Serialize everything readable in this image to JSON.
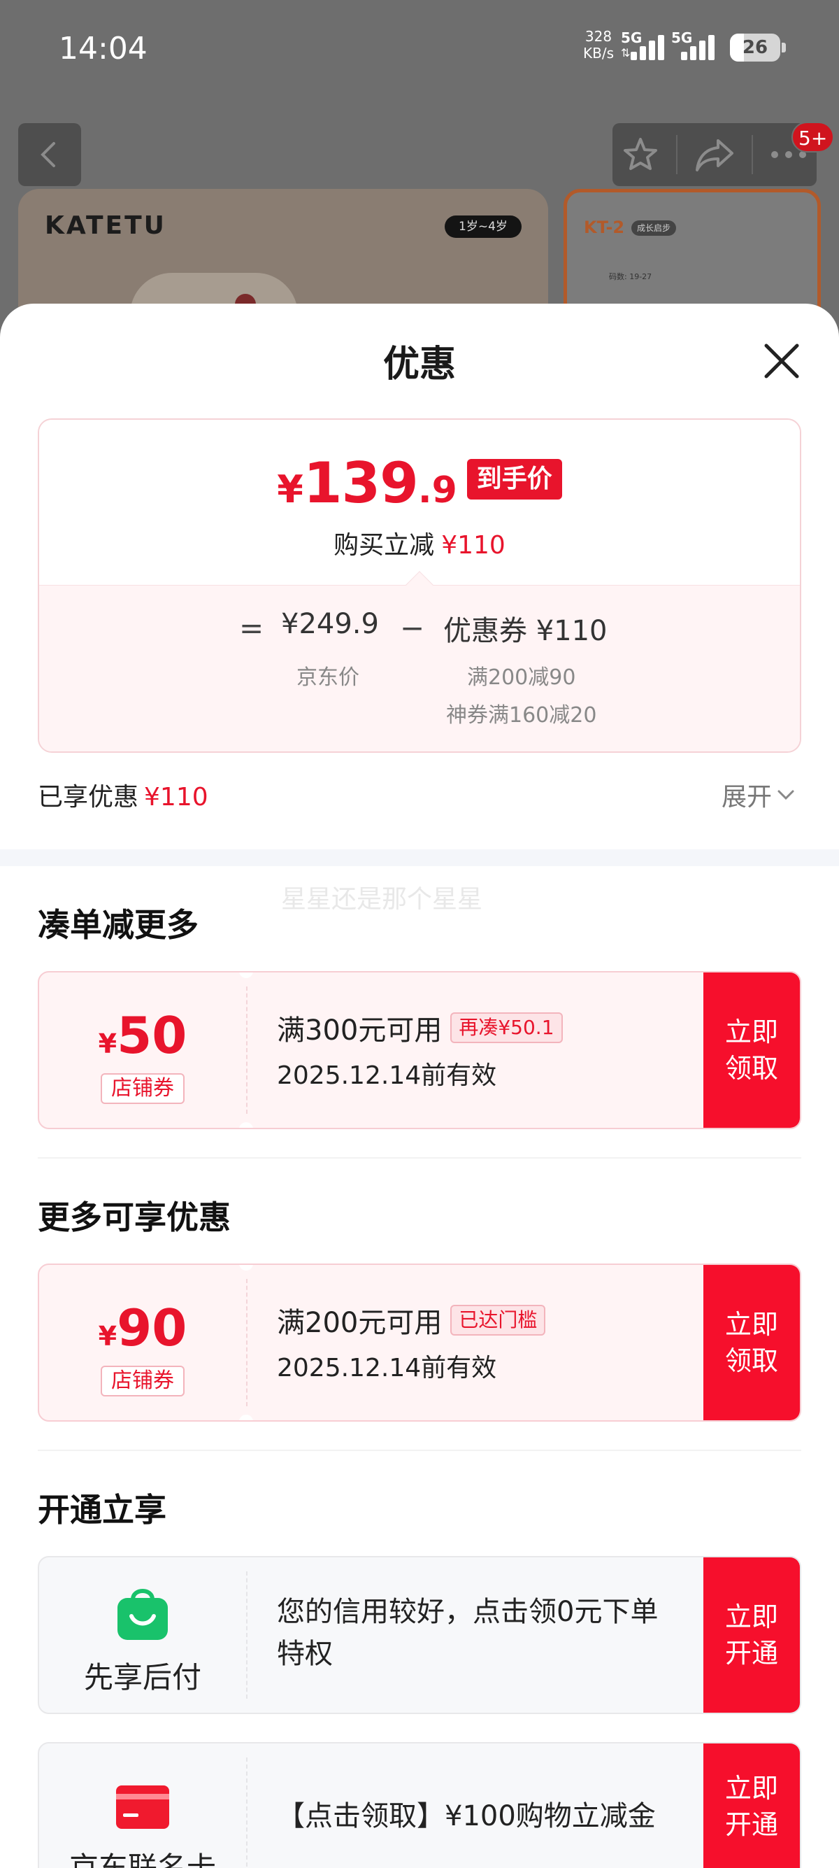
{
  "status_bar": {
    "time": "14:04",
    "net_speed": "328",
    "net_unit": "KB/s",
    "sim1": "5G",
    "sim2": "5G",
    "battery": "26"
  },
  "background": {
    "brand": "KATETU",
    "age_tag": "1岁~4岁",
    "notif_count": "5+",
    "kt_model": "KT-2",
    "kt_tag": "成长启步",
    "kt_size": "码数: 19-27"
  },
  "sheet": {
    "title": "优惠",
    "final_price": {
      "currency": "¥",
      "integer": "139",
      "decimal": ".9",
      "tag": "到手价"
    },
    "instant_label": "购买立减",
    "instant_amount": "¥110",
    "formula": {
      "equals": "=",
      "jd_price": "¥249.9",
      "jd_label": "京东价",
      "minus": "−",
      "coupon_label": "优惠券 ¥110",
      "coupon_rule1": "满200减90",
      "coupon_rule2": "神券满160减20"
    },
    "enjoyed_label": "已享优惠",
    "enjoyed_amount": "¥110",
    "expand_label": "展开"
  },
  "watermark": "星星还是那个星星",
  "section_more_off": {
    "title": "凑单减更多",
    "coupon": {
      "currency": "¥",
      "amount": "50",
      "type": "店铺券",
      "condition": "满300元可用",
      "badge": "再凑¥50.1",
      "valid_until": "2025.12.14前有效",
      "button": "立即\n领取"
    }
  },
  "section_more_deals": {
    "title": "更多可享优惠",
    "coupon": {
      "currency": "¥",
      "amount": "90",
      "type": "店铺券",
      "condition": "满200元可用",
      "badge": "已达门槛",
      "valid_until": "2025.12.14前有效",
      "button": "立即\n领取"
    }
  },
  "section_activate": {
    "title": "开通立享",
    "items": [
      {
        "name": "先享后付",
        "desc": "您的信用较好，点击领0元下单特权",
        "button": "立即\n开通",
        "icon_color": "#19c26b"
      },
      {
        "name": "京东联名卡",
        "desc": "【点击领取】¥100购物立减金",
        "button": "立即\n开通",
        "icon_color": "#f01a2e"
      }
    ]
  },
  "colors": {
    "accent_red": "#e8142c",
    "button_red": "#f60f2c"
  }
}
